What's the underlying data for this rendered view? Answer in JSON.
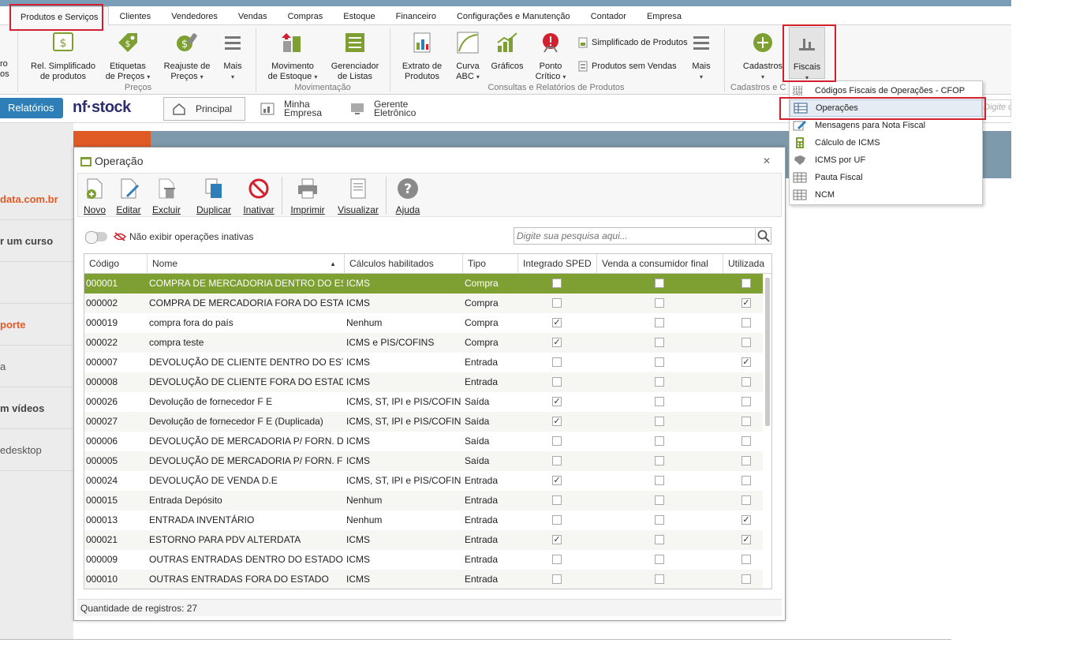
{
  "menu_tabs": [
    "Produtos e Serviços",
    "Clientes",
    "Vendedores",
    "Vendas",
    "Compras",
    "Estoque",
    "Financeiro",
    "Configurações e Manutenção",
    "Contador",
    "Empresa"
  ],
  "ribbon": {
    "cut_left": {
      "line1": "ro",
      "line2": "os"
    },
    "buttons": {
      "rel_simplificado": {
        "line1": "Rel. Simplificado",
        "line2": "de produtos"
      },
      "etiquetas": {
        "line1": "Etiquetas",
        "line2": "de Preços"
      },
      "reajuste": {
        "line1": "Reajuste de",
        "line2": "Preços"
      },
      "mais1": {
        "line1": "Mais"
      },
      "movimento": {
        "line1": "Movimento",
        "line2": "de Estoque"
      },
      "gerenciador": {
        "line1": "Gerenciador",
        "line2": "de Listas"
      },
      "extrato": {
        "line1": "Extrato de",
        "line2": "Produtos"
      },
      "curva": {
        "line1": "Curva",
        "line2": "ABC"
      },
      "graficos": {
        "line1": "Gráficos"
      },
      "ponto": {
        "line1": "Ponto",
        "line2": "Crítico"
      },
      "mais2": {
        "line1": "Mais"
      },
      "cadastros": {
        "line1": "Cadastros"
      },
      "fiscais": {
        "line1": "Fiscais"
      }
    },
    "small": {
      "simplificado": "Simplificado de Produtos",
      "sem_vendas": "Produtos sem Vendas"
    },
    "groups": {
      "precos": "Preços",
      "movimentacao": "Movimentação",
      "consultas": "Consultas e Relatórios de Produtos",
      "cadastros": "Cadastros e Co"
    },
    "arrow": "▾"
  },
  "toolbar2": {
    "relatorios": "Relatórios",
    "brand": "nf·stock",
    "principal": "Principal",
    "minha_empresa": {
      "line1": "Minha",
      "line2": "Empresa"
    },
    "gerente": {
      "line1": "Gerente",
      "line2": "Eletrônico"
    },
    "search_placeholder": "Digite o"
  },
  "sidebar": [
    "data.com.br",
    "r um curso",
    "",
    "porte",
    "a",
    "m vídeos",
    "edesktop"
  ],
  "dialog": {
    "title": "Operação",
    "close": "✕",
    "tools": [
      "Novo",
      "Editar",
      "Excluir",
      "Duplicar",
      "Inativar",
      "Imprimir",
      "Visualizar",
      "Ajuda"
    ],
    "filter_label": "Não exibir operações inativas",
    "search_placeholder": "Digite sua pesquisa aqui...",
    "columns": [
      "Código",
      "Nome",
      "Cálculos habilitados",
      "Tipo",
      "Integrado SPED",
      "Venda a consumidor final",
      "Utilizada"
    ],
    "sort_indicator": "▲",
    "check": "✓",
    "rows": [
      {
        "codigo": "000001",
        "nome": "COMPRA DE MERCADORIA DENTRO DO ESTADO",
        "calculos": "ICMS",
        "tipo": "Compra",
        "sped": false,
        "consumidor": false,
        "utilizada": false
      },
      {
        "codigo": "000002",
        "nome": "COMPRA DE MERCADORIA FORA DO ESTADO",
        "calculos": "ICMS",
        "tipo": "Compra",
        "sped": false,
        "consumidor": false,
        "utilizada": true
      },
      {
        "codigo": "000019",
        "nome": "compra fora do país",
        "calculos": "Nenhum",
        "tipo": "Compra",
        "sped": true,
        "consumidor": false,
        "utilizada": false
      },
      {
        "codigo": "000022",
        "nome": "compra teste",
        "calculos": "ICMS e PIS/COFINS",
        "tipo": "Compra",
        "sped": true,
        "consumidor": false,
        "utilizada": false
      },
      {
        "codigo": "000007",
        "nome": "DEVOLUÇÃO DE CLIENTE DENTRO DO ESTADO",
        "calculos": "ICMS",
        "tipo": "Entrada",
        "sped": false,
        "consumidor": false,
        "utilizada": true
      },
      {
        "codigo": "000008",
        "nome": "DEVOLUÇÃO DE CLIENTE FORA DO ESTADO",
        "calculos": "ICMS",
        "tipo": "Entrada",
        "sped": false,
        "consumidor": false,
        "utilizada": false
      },
      {
        "codigo": "000026",
        "nome": "Devolução de fornecedor F E",
        "calculos": "ICMS, ST, IPI e PIS/COFINS",
        "tipo": "Saída",
        "sped": true,
        "consumidor": false,
        "utilizada": false
      },
      {
        "codigo": "000027",
        "nome": "Devolução de fornecedor F E (Duplicada)",
        "calculos": "ICMS, ST, IPI e PIS/COFINS",
        "tipo": "Saída",
        "sped": true,
        "consumidor": false,
        "utilizada": false
      },
      {
        "codigo": "000006",
        "nome": "DEVOLUÇÃO DE MERCADORIA P/ FORN. DENTRO",
        "calculos": "ICMS",
        "tipo": "Saída",
        "sped": false,
        "consumidor": false,
        "utilizada": false
      },
      {
        "codigo": "000005",
        "nome": "DEVOLUÇÃO DE MERCADORIA P/ FORN. FORA",
        "calculos": "ICMS",
        "tipo": "Saída",
        "sped": false,
        "consumidor": false,
        "utilizada": false
      },
      {
        "codigo": "000024",
        "nome": "DEVOLUÇÃO DE VENDA D.E",
        "calculos": "ICMS, ST, IPI e PIS/COFINS",
        "tipo": "Entrada",
        "sped": true,
        "consumidor": false,
        "utilizada": false
      },
      {
        "codigo": "000015",
        "nome": "Entrada Depósito",
        "calculos": "Nenhum",
        "tipo": "Entrada",
        "sped": false,
        "consumidor": false,
        "utilizada": false
      },
      {
        "codigo": "000013",
        "nome": "ENTRADA INVENTÁRIO",
        "calculos": "Nenhum",
        "tipo": "Entrada",
        "sped": false,
        "consumidor": false,
        "utilizada": true
      },
      {
        "codigo": "000021",
        "nome": "ESTORNO PARA PDV ALTERDATA",
        "calculos": "ICMS",
        "tipo": "Entrada",
        "sped": true,
        "consumidor": false,
        "utilizada": true
      },
      {
        "codigo": "000009",
        "nome": "OUTRAS ENTRADAS DENTRO DO ESTADO",
        "calculos": "ICMS",
        "tipo": "Entrada",
        "sped": false,
        "consumidor": false,
        "utilizada": false
      },
      {
        "codigo": "000010",
        "nome": "OUTRAS ENTRADAS FORA DO ESTADO",
        "calculos": "ICMS",
        "tipo": "Entrada",
        "sped": false,
        "consumidor": false,
        "utilizada": false
      }
    ],
    "status": "Quantidade de registros:  27"
  },
  "fiscais_menu": [
    "Códigos Fiscais de Operações - CFOP",
    "Operações",
    "Mensagens para Nota Fiscal",
    "Cálculo de ICMS",
    "ICMS por UF",
    "Pauta Fiscal",
    "NCM"
  ],
  "colors": {
    "accent_green": "#7ea032",
    "highlight_red": "#d2202e",
    "relatorios_blue": "#2e7fb8",
    "orange": "#e05a26",
    "steel_blue": "#7e99ab"
  }
}
